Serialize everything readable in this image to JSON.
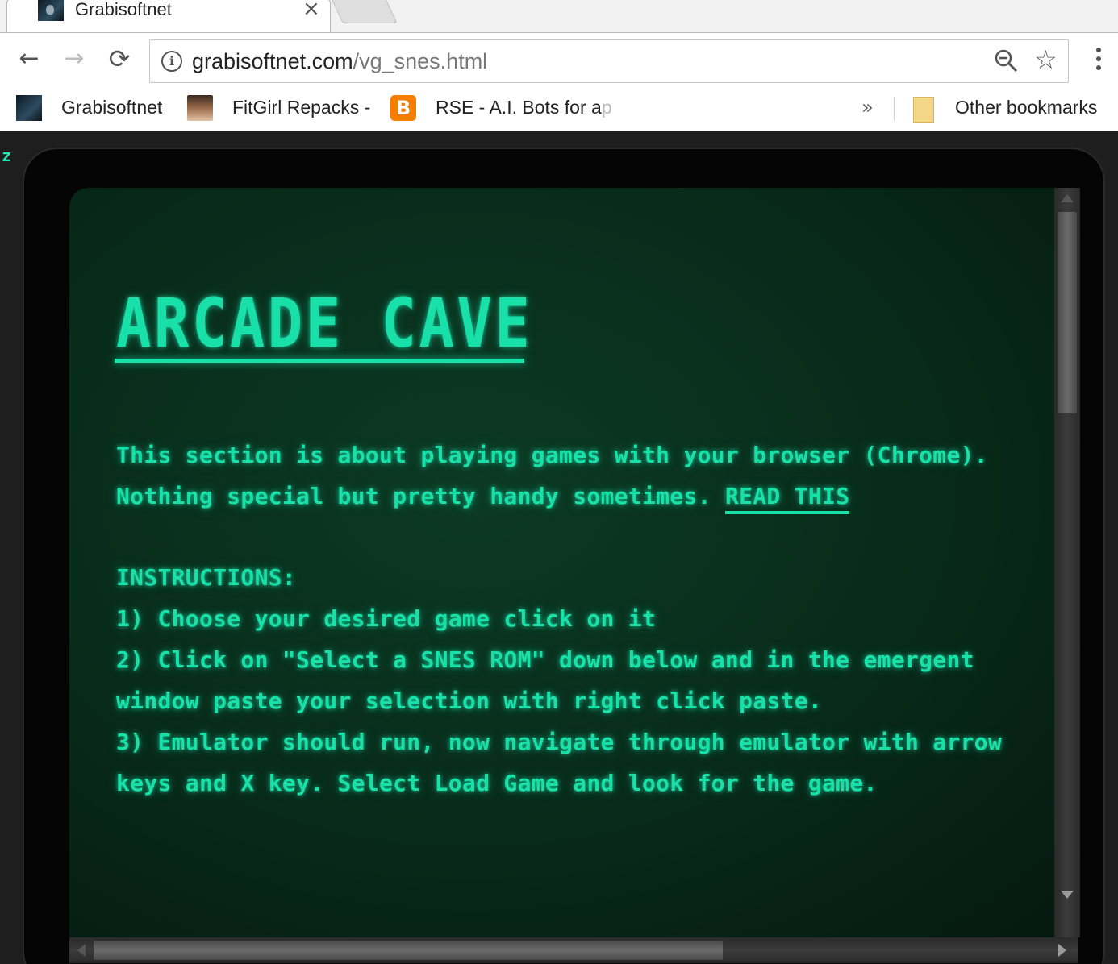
{
  "browser": {
    "tab_title": "Grabisoftnet",
    "tab_close": "×",
    "url_host": "grabisoftnet.com",
    "url_path": "/vg_snes.html",
    "back_glyph": "←",
    "forward_glyph": "→",
    "reload_glyph": "⟳",
    "star_glyph": "☆",
    "info_glyph": "i",
    "icons": [
      "back-icon",
      "forward-icon",
      "reload-icon",
      "info-icon",
      "zoom-icon",
      "star-icon",
      "menu-icon"
    ]
  },
  "bookmarks": {
    "items": [
      {
        "label": "Grabisoftnet",
        "icon": "grabisoftnet-favicon"
      },
      {
        "label": "FitGirl Repacks -",
        "icon": "fitgirl-favicon"
      },
      {
        "label": "RSE - A.I. Bots for a",
        "fade": "p",
        "icon": "blogger-icon"
      }
    ],
    "blogger_glyph": "B",
    "more_glyph": "»",
    "other": "Other bookmarks"
  },
  "page": {
    "corner_letter": "z",
    "title": "ARCADE CAVE",
    "intro_line1": "This section is about playing games with your browser (Chrome).",
    "intro_line2": "Nothing special but pretty handy sometimes. ",
    "read_this": "READ THIS",
    "instructions_heading": "INSTRUCTIONS:",
    "steps": [
      "1) Choose your desired game click on it",
      "2) Click on \"Select a SNES ROM\" down below and in the emergent",
      "window paste your selection with right click paste.",
      "3) Emulator should run, now navigate through emulator with arrow",
      "keys and X key. Select Load Game and look for the game."
    ],
    "colors": {
      "text": "#19e0a8",
      "screen": "#082a1a"
    }
  }
}
